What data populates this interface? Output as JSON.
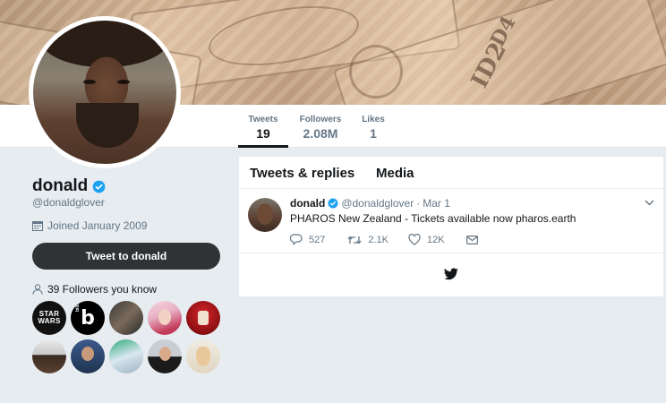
{
  "profile": {
    "display_name": "donald",
    "handle": "@donaldglover",
    "joined": "Joined January 2009",
    "tweet_button": "Tweet to donald",
    "followers_you_know": "39 Followers you know"
  },
  "stats": [
    {
      "label": "Tweets",
      "value": "19"
    },
    {
      "label": "Followers",
      "value": "2.08M"
    },
    {
      "label": "Likes",
      "value": "1"
    }
  ],
  "timeline": {
    "tabs": [
      "Tweets & replies",
      "Media"
    ],
    "tweet": {
      "name": "donald",
      "handle": "@donaldglover",
      "separator": "·",
      "date": "Mar 1",
      "text": "PHAROS New Zealand - Tickets available now pharos.earth",
      "replies": "527",
      "retweets": "2.1K",
      "likes": "12K"
    }
  },
  "banner_text": {
    "serial": "ID2",
    "letters": "D4"
  },
  "followed_avatars": [
    {
      "label": "STAR WARS"
    },
    {
      "label": "billboard"
    }
  ],
  "colors": {
    "accent": "#1da1f2",
    "button_dark": "#2f3336",
    "page_bg": "#e6ecf0",
    "text_secondary": "#657786"
  },
  "icons": {
    "verified": "verified-badge-icon",
    "calendar": "calendar-icon",
    "followers": "person-icon",
    "reply": "reply-icon",
    "retweet": "retweet-icon",
    "like": "heart-icon",
    "dm": "envelope-icon",
    "chevron": "chevron-down-icon",
    "bird": "twitter-bird-icon"
  }
}
